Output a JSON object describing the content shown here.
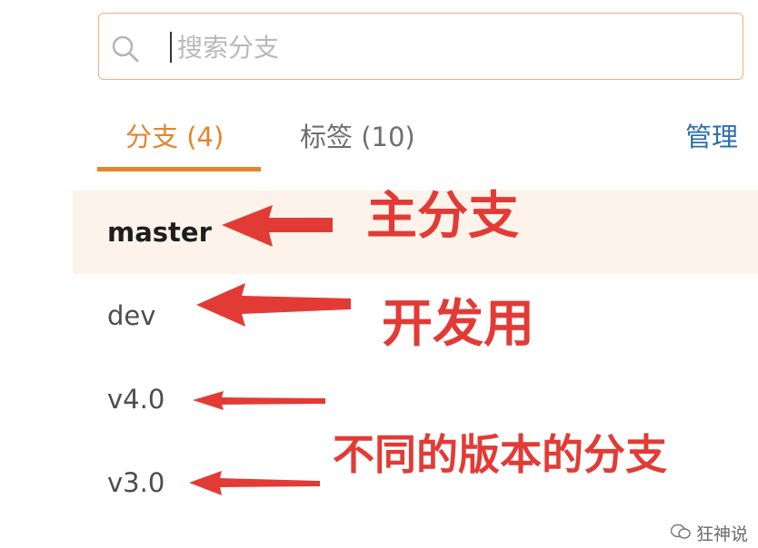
{
  "search": {
    "placeholder": "搜索分支",
    "value": ""
  },
  "tabs": [
    {
      "label": "分支 (4)",
      "active": true
    },
    {
      "label": "标签 (10)",
      "active": false
    }
  ],
  "manage_label": "管理",
  "branches": [
    {
      "name": "master",
      "selected": true
    },
    {
      "name": "dev",
      "selected": false
    },
    {
      "name": "v4.0",
      "selected": false
    },
    {
      "name": "v3.0",
      "selected": false
    }
  ],
  "annotations": {
    "main_branch": "主分支",
    "dev_use": "开发用",
    "version_branches": "不同的版本的分支"
  },
  "watermark": {
    "text": "狂神说",
    "icon": "wechat-icon"
  },
  "colors": {
    "accent": "#e4842e",
    "link": "#2a6fb0",
    "annotation": "#e23b36",
    "selected_row_bg": "#fdf3ea",
    "search_border": "#f0b082"
  }
}
